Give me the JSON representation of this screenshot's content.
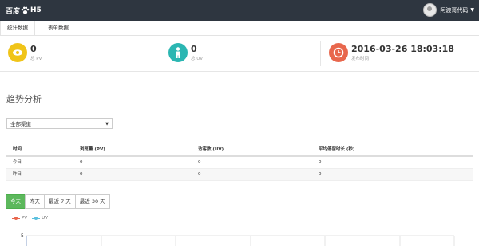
{
  "app": {
    "logo_text": "百度",
    "logo_suffix": "H5"
  },
  "user": {
    "name": "阿渡哥代码"
  },
  "tabs": [
    {
      "label": "统计数据"
    },
    {
      "label": "表单数据"
    }
  ],
  "stats": [
    {
      "value": "0",
      "label": "总 PV",
      "color": "#f0c419",
      "icon": "eye-icon"
    },
    {
      "value": "0",
      "label": "总 UV",
      "color": "#2bb6b2",
      "icon": "person-icon"
    },
    {
      "value": "2016-03-26 18:03:18",
      "label": "发布时间",
      "color": "#e8674d",
      "icon": "clock-icon"
    }
  ],
  "section_title": "趋势分析",
  "channel_select": {
    "value": "全部渠道"
  },
  "table": {
    "headers": [
      "时间",
      "浏览量 (PV)",
      "访客数 (UV)",
      "平均停留时长 (秒)"
    ],
    "rows": [
      [
        "今日",
        "0",
        "0",
        "0"
      ],
      [
        "昨日",
        "0",
        "0",
        "0"
      ]
    ]
  },
  "range_buttons": [
    "今天",
    "昨天",
    "最近 7 天",
    "最近 30 天"
  ],
  "legend": [
    {
      "name": "PV",
      "color": "#e8674d"
    },
    {
      "name": "UV",
      "color": "#5bc0de"
    }
  ],
  "chart_data": {
    "type": "line",
    "series": [
      {
        "name": "PV"
      },
      {
        "name": "UV"
      }
    ],
    "y_ticks": [
      "5"
    ]
  }
}
